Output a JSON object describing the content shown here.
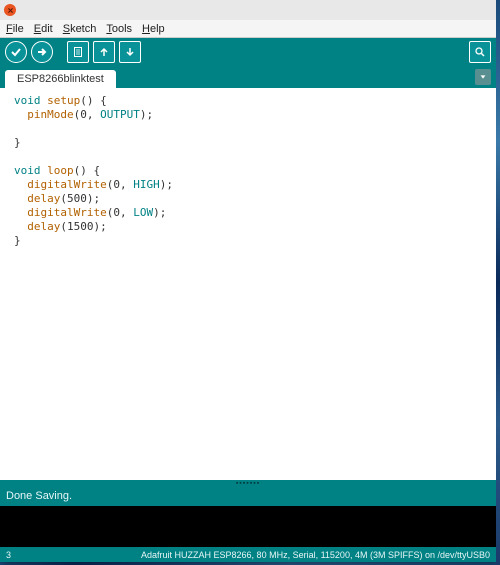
{
  "menu": {
    "file": "File",
    "edit": "Edit",
    "sketch": "Sketch",
    "tools": "Tools",
    "help": "Help"
  },
  "tab": {
    "name": "ESP8266blinktest"
  },
  "code": {
    "setup_decl_kw": "void",
    "setup_decl_name": "setup",
    "setup_decl_rest": "() {",
    "pinmode_fn": "pinMode",
    "pinmode_args": "(0, ",
    "pinmode_const": "OUTPUT",
    "pinmode_end": ");",
    "brace_close": "}",
    "loop_decl_kw": "void",
    "loop_decl_name": "loop",
    "loop_decl_rest": "() {",
    "dw1_fn": "digitalWrite",
    "dw1_args": "(0, ",
    "dw1_const": "HIGH",
    "dw1_end": ");",
    "delay1_fn": "delay",
    "delay1_args": "(500);",
    "dw2_fn": "digitalWrite",
    "dw2_args": "(0, ",
    "dw2_const": "LOW",
    "dw2_end": ");",
    "delay2_fn": "delay",
    "delay2_args": "(1500);"
  },
  "status": {
    "message": "Done Saving."
  },
  "footer": {
    "line": "3",
    "board": "Adafruit HUZZAH ESP8266, 80 MHz, Serial, 115200, 4M (3M SPIFFS) on /dev/ttyUSB0"
  }
}
